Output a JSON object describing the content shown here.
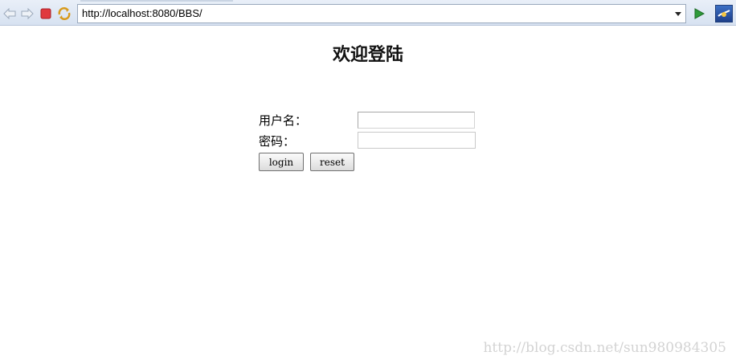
{
  "browser": {
    "address_url": "http://localhost:8080/BBS/",
    "icons": {
      "back": "back-arrow-icon",
      "forward": "forward-arrow-icon",
      "stop": "stop-icon",
      "refresh": "refresh-icon",
      "dropdown": "chevron-down-icon",
      "go": "go-play-icon",
      "extension": "browser-extension-icon"
    },
    "colors": {
      "toolbar_bg": "#dde6f3",
      "stop_red": "#e0393e",
      "go_green": "#2e9a3a"
    }
  },
  "page": {
    "title": "欢迎登陆",
    "form": {
      "username_label": "用户名：",
      "username_value": "",
      "password_label": "密码：",
      "password_value": "",
      "login_label": "login",
      "reset_label": "reset"
    },
    "watermark": "http://blog.csdn.net/sun980984305"
  }
}
